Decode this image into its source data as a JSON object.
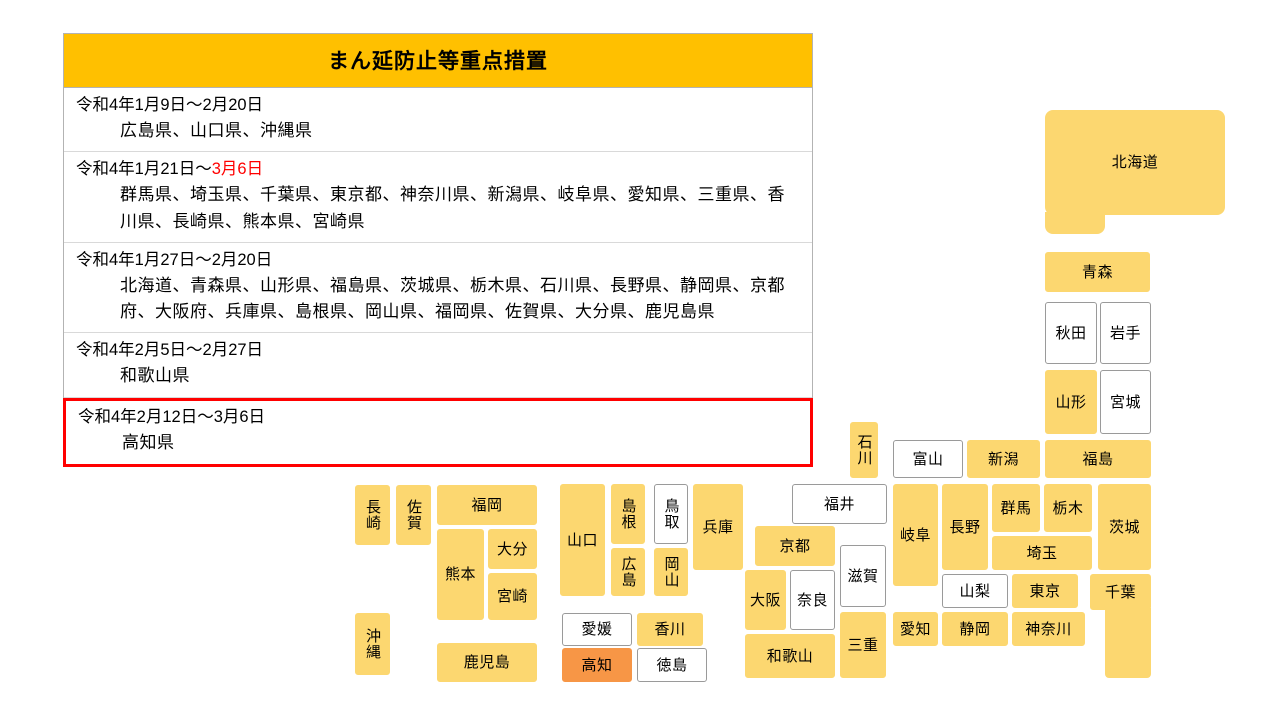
{
  "panel": {
    "title": "まん延防止等重点措置",
    "rows": [
      {
        "period_prefix": "令和4年1月9日～2月20日",
        "period_red": "",
        "prefectures": "広島県、山口県、沖縄県",
        "highlighted": false
      },
      {
        "period_prefix": "令和4年1月21日～",
        "period_red": "3月6日",
        "prefectures": "群馬県、埼玉県、千葉県、東京都、神奈川県、新潟県、岐阜県、愛知県、三重県、香川県、長崎県、熊本県、宮崎県",
        "highlighted": false
      },
      {
        "period_prefix": "令和4年1月27日～2月20日",
        "period_red": "",
        "prefectures": "北海道、青森県、山形県、福島県、茨城県、栃木県、石川県、長野県、静岡県、京都府、大阪府、兵庫県、島根県、岡山県、福岡県、佐賀県、大分県、鹿児島県",
        "highlighted": false
      },
      {
        "period_prefix": "令和4年2月5日～2月27日",
        "period_red": "",
        "prefectures": "和歌山県",
        "highlighted": false
      },
      {
        "period_prefix": "令和4年2月12日～3月6日",
        "period_red": "",
        "prefectures": "高知県",
        "highlighted": true
      }
    ]
  },
  "colors": {
    "header_amber": "#FFC000",
    "pref_active": "#FCD770",
    "pref_new": "#F79646",
    "pref_inactive": "#FFFFFF",
    "highlight_border": "#FF0000",
    "date_red": "#FF0000"
  },
  "map": {
    "prefectures": [
      {
        "id": "hokkaido",
        "label": "北海道",
        "state": "on"
      },
      {
        "id": "aomori",
        "label": "青森",
        "state": "on"
      },
      {
        "id": "akita",
        "label": "秋田",
        "state": "off"
      },
      {
        "id": "iwate",
        "label": "岩手",
        "state": "off"
      },
      {
        "id": "yamagata",
        "label": "山形",
        "state": "on"
      },
      {
        "id": "miyagi",
        "label": "宮城",
        "state": "off"
      },
      {
        "id": "fukushima",
        "label": "福島",
        "state": "on"
      },
      {
        "id": "niigata",
        "label": "新潟",
        "state": "on"
      },
      {
        "id": "toyama",
        "label": "富山",
        "state": "off"
      },
      {
        "id": "ishikawa",
        "label": "石川",
        "state": "on"
      },
      {
        "id": "fukui",
        "label": "福井",
        "state": "off"
      },
      {
        "id": "gifu",
        "label": "岐阜",
        "state": "on"
      },
      {
        "id": "nagano",
        "label": "長野",
        "state": "on"
      },
      {
        "id": "gunma",
        "label": "群馬",
        "state": "on"
      },
      {
        "id": "tochigi",
        "label": "栃木",
        "state": "on"
      },
      {
        "id": "ibaraki",
        "label": "茨城",
        "state": "on"
      },
      {
        "id": "saitama",
        "label": "埼玉",
        "state": "on"
      },
      {
        "id": "yamanashi",
        "label": "山梨",
        "state": "off"
      },
      {
        "id": "tokyo",
        "label": "東京",
        "state": "on"
      },
      {
        "id": "chiba",
        "label": "千葉",
        "state": "on"
      },
      {
        "id": "shizuoka",
        "label": "静岡",
        "state": "on"
      },
      {
        "id": "kanagawa",
        "label": "神奈川",
        "state": "on"
      },
      {
        "id": "aichi",
        "label": "愛知",
        "state": "on"
      },
      {
        "id": "shiga",
        "label": "滋賀",
        "state": "off"
      },
      {
        "id": "mie",
        "label": "三重",
        "state": "on"
      },
      {
        "id": "kyoto",
        "label": "京都",
        "state": "on"
      },
      {
        "id": "nara",
        "label": "奈良",
        "state": "off"
      },
      {
        "id": "osaka",
        "label": "大阪",
        "state": "on"
      },
      {
        "id": "wakayama",
        "label": "和歌山",
        "state": "on"
      },
      {
        "id": "hyogo",
        "label": "兵庫",
        "state": "on"
      },
      {
        "id": "tottori",
        "label": "鳥取",
        "state": "off"
      },
      {
        "id": "okayama",
        "label": "岡山",
        "state": "on"
      },
      {
        "id": "shimane",
        "label": "島根",
        "state": "on"
      },
      {
        "id": "hiroshima",
        "label": "広島",
        "state": "on"
      },
      {
        "id": "yamaguchi",
        "label": "山口",
        "state": "on"
      },
      {
        "id": "kagawa",
        "label": "香川",
        "state": "on"
      },
      {
        "id": "tokushima",
        "label": "徳島",
        "state": "off"
      },
      {
        "id": "ehime",
        "label": "愛媛",
        "state": "off"
      },
      {
        "id": "kochi",
        "label": "高知",
        "state": "new"
      },
      {
        "id": "fukuoka",
        "label": "福岡",
        "state": "on"
      },
      {
        "id": "saga",
        "label": "佐賀",
        "state": "on"
      },
      {
        "id": "nagasaki",
        "label": "長崎",
        "state": "on"
      },
      {
        "id": "oita",
        "label": "大分",
        "state": "on"
      },
      {
        "id": "kumamoto",
        "label": "熊本",
        "state": "on"
      },
      {
        "id": "miyazaki",
        "label": "宮崎",
        "state": "on"
      },
      {
        "id": "kagoshima",
        "label": "鹿児島",
        "state": "on"
      },
      {
        "id": "okinawa",
        "label": "沖縄",
        "state": "on"
      }
    ]
  }
}
